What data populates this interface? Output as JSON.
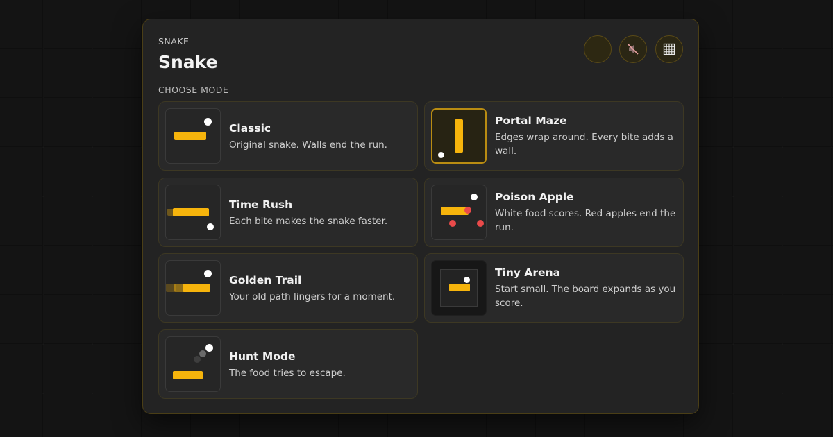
{
  "header": {
    "eyebrow": "SNAKE",
    "title": "Snake",
    "section_label": "CHOOSE MODE"
  },
  "controls": {
    "icons": [
      "blank-round-button",
      "speaker-muted-icon",
      "grid-icon"
    ]
  },
  "modes": [
    {
      "name": "Classic",
      "desc": "Original snake. Walls end the run.",
      "selected": false
    },
    {
      "name": "Portal Maze",
      "desc": "Edges wrap around. Every bite adds a wall.",
      "selected": true
    },
    {
      "name": "Time Rush",
      "desc": "Each bite makes the snake faster.",
      "selected": false
    },
    {
      "name": "Poison Apple",
      "desc": "White food scores. Red apples end the run.",
      "selected": false
    },
    {
      "name": "Golden Trail",
      "desc": "Your old path lingers for a moment.",
      "selected": false
    },
    {
      "name": "Tiny Arena",
      "desc": "Start small. The board expands as you score.",
      "selected": false
    },
    {
      "name": "Hunt Mode",
      "desc": "The food tries to escape.",
      "selected": false
    }
  ],
  "colors": {
    "accent": "#f6b40c",
    "food": "#ffffff",
    "poison": "#ea4a4a",
    "panel": "#232323",
    "border": "#4a3e16"
  }
}
